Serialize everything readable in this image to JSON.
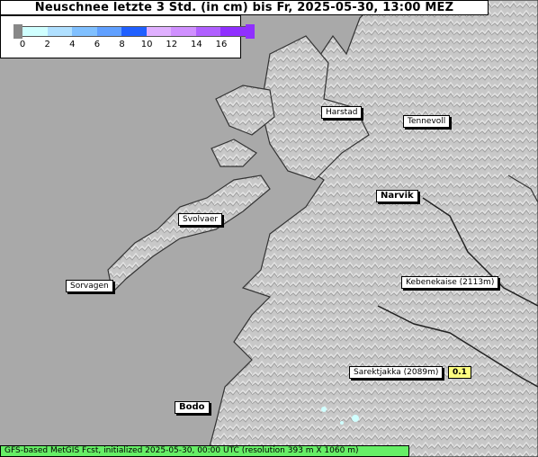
{
  "title": "Neuschnee letzte 3 Std. (in cm) bis Fr, 2025-05-30, 13:00 MEZ",
  "legend": {
    "ticks": [
      "0",
      "2",
      "4",
      "6",
      "8",
      "10",
      "12",
      "14",
      "16"
    ],
    "colors": [
      "#d0ffff",
      "#b0e0ff",
      "#80c0ff",
      "#60a0ff",
      "#2060ff",
      "#e0b0ff",
      "#d090ff",
      "#b060ff",
      "#9030ff"
    ]
  },
  "colors": {
    "sea": "#a9a9a9",
    "land": "#c8c8c8",
    "footer_bg": "#66ee66",
    "value_badge": "#ffff80"
  },
  "places": [
    {
      "name": "Harstad",
      "bold": false
    },
    {
      "name": "Tennevoll",
      "bold": false
    },
    {
      "name": "Narvik",
      "bold": true
    },
    {
      "name": "Svolvaer",
      "bold": false
    },
    {
      "name": "Sorvagen",
      "bold": false
    },
    {
      "name": "Kebenekaise (2113m)",
      "bold": false
    },
    {
      "name": "Sarektjakka (2089m)",
      "bold": false
    },
    {
      "name": "Bodo",
      "bold": true
    }
  ],
  "point_values": [
    {
      "place": "Sarektjakka (2089m)",
      "value": "0.1"
    }
  ],
  "footer": "GFS-based MetGIS Fcst, initialized 2025-05-30, 00:00 UTC  (resolution 393 m X 1060 m)"
}
